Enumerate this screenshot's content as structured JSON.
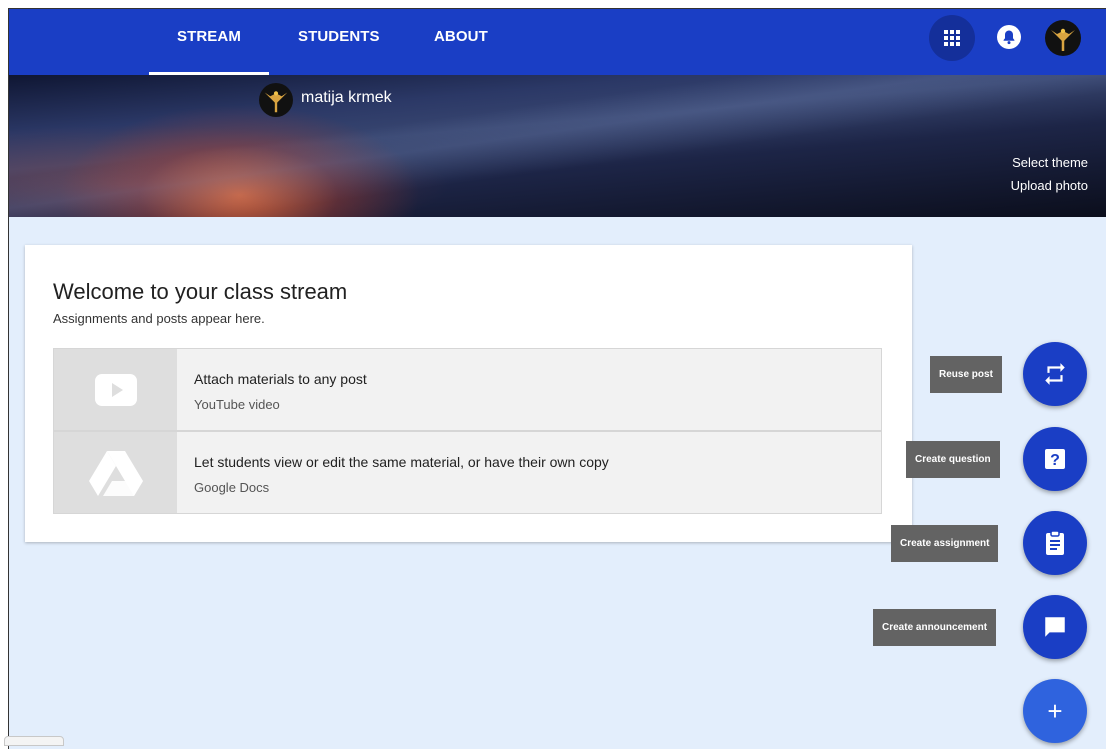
{
  "nav": {
    "tabs": [
      {
        "label": "STREAM",
        "active": true
      },
      {
        "label": "STUDENTS",
        "active": false
      },
      {
        "label": "ABOUT",
        "active": false
      }
    ],
    "icons": [
      "apps-grid-icon",
      "notifications-icon",
      "avatar"
    ]
  },
  "banner": {
    "user_name": "matija krmek",
    "select_theme": "Select theme",
    "upload_photo": "Upload photo"
  },
  "welcome": {
    "title": "Welcome to your class stream",
    "subtitle": "Assignments and posts appear here.",
    "materials": [
      {
        "title": "Attach materials to any post",
        "description": "YouTube video",
        "icon": "youtube-icon"
      },
      {
        "title": "Let students view or edit the same material, or have their own copy",
        "description": "Google Docs",
        "icon": "google-drive-icon"
      }
    ]
  },
  "fab_menu": {
    "items": [
      {
        "label": "Reuse post",
        "icon": "repeat-icon"
      },
      {
        "label": "Create question",
        "icon": "question-icon"
      },
      {
        "label": "Create assignment",
        "icon": "assignment-icon"
      },
      {
        "label": "Create announcement",
        "icon": "announcement-icon"
      }
    ],
    "main_symbol": "+"
  },
  "colors": {
    "primary": "#1a3ec5",
    "fab_main": "#2f63de",
    "background": "#e3eefc",
    "label_bg": "#636363"
  }
}
